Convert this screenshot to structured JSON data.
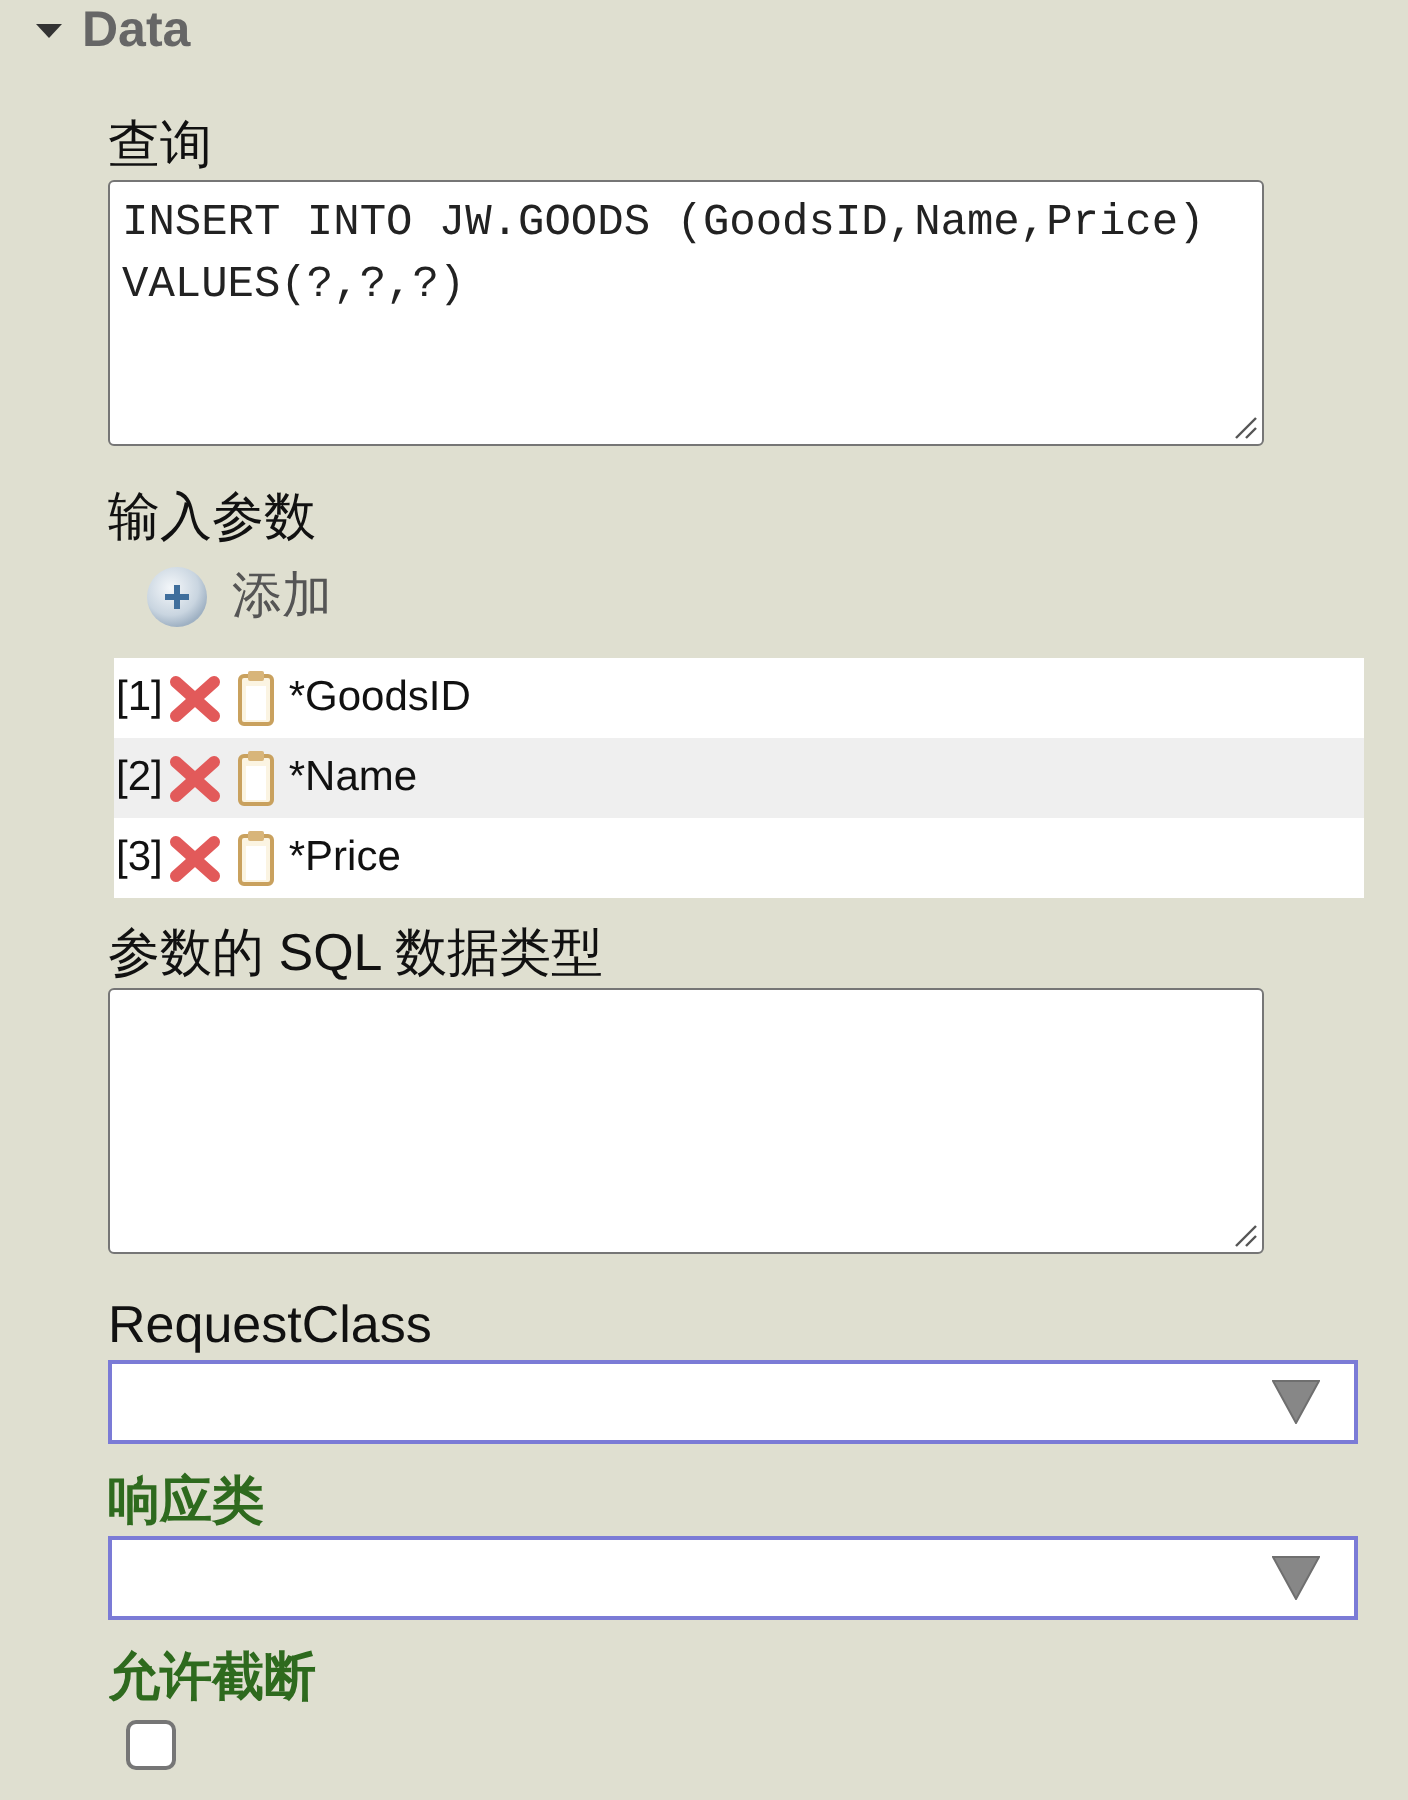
{
  "section": {
    "title": "Data",
    "expanded": true
  },
  "fields": [
    {
      "kind": "textarea",
      "label": "查询",
      "emphasized": false,
      "value": "INSERT INTO JW.GOODS (GoodsID,Name,Price) VALUES(?,?,?)"
    },
    {
      "kind": "params",
      "label": "输入参数",
      "emphasized": false,
      "add_button": "添加",
      "rows": [
        {
          "index": "[1]",
          "name": "*GoodsID"
        },
        {
          "index": "[2]",
          "name": "*Name"
        },
        {
          "index": "[3]",
          "name": "*Price"
        }
      ]
    },
    {
      "kind": "textarea",
      "label": "参数的 SQL 数据类型",
      "emphasized": false
    },
    {
      "kind": "select",
      "label": "RequestClass",
      "emphasized": false
    },
    {
      "kind": "select",
      "label": "响应类",
      "emphasized": true
    },
    {
      "kind": "checkbox",
      "label": "允许截断",
      "emphasized": true,
      "checked": false
    }
  ]
}
